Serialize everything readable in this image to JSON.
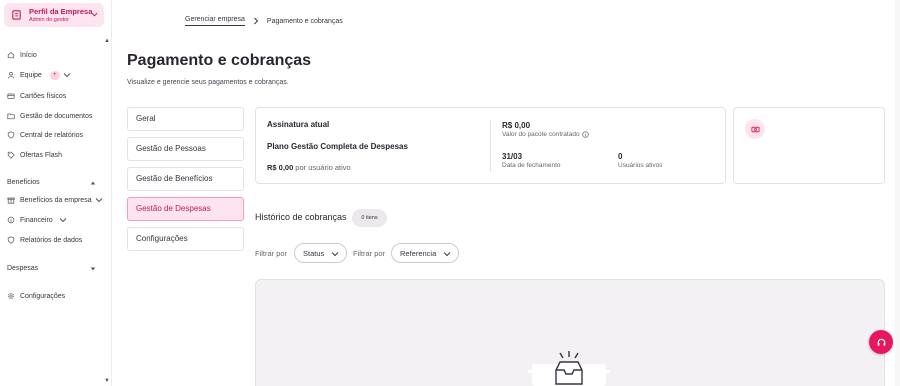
{
  "company": {
    "name": "Perfil da Empresa",
    "role": "Admin do gestor"
  },
  "sidebar": {
    "items": [
      {
        "label": "Início",
        "icon": "home-icon"
      },
      {
        "label": "Equipe",
        "icon": "users-icon",
        "badge": "+"
      },
      {
        "label": "Cartões físicos",
        "icon": "card-icon"
      },
      {
        "label": "Gestão de documentos",
        "icon": "folder-icon"
      },
      {
        "label": "Central de relatórios",
        "icon": "shield-icon"
      },
      {
        "label": "Ofertas Flash",
        "icon": "tag-icon"
      }
    ],
    "section_beneficios": "Benefícios",
    "beneficios_items": [
      {
        "label": "Benefícios da empresa",
        "icon": "gift-icon"
      },
      {
        "label": "Financeiro",
        "icon": "coin-icon"
      },
      {
        "label": "Relatórios de dados",
        "icon": "shield-icon"
      }
    ],
    "section_despesas": "Despesas",
    "settings": {
      "label": "Configurações",
      "icon": "gear-icon"
    }
  },
  "breadcrumb": {
    "parent": "Gerenciar empresa",
    "current": "Pagamento e cobranças"
  },
  "page": {
    "title": "Pagamento e cobranças",
    "subtitle": "Visualize e gerencie seus pagamentos e cobranças."
  },
  "nav": {
    "items": [
      "Geral",
      "Gestão de Pessoas",
      "Gestão de Benefícios",
      "Gestão de Despesas",
      "Configurações"
    ],
    "active_index": 3
  },
  "subscription": {
    "header": "Assinatura atual",
    "plan": "Plano Gestão Completa de Despesas",
    "price": "R$ 0,00",
    "price_unit": "por usuário ativo",
    "package_value": "R$ 0,00",
    "package_label": "Valor do pacote contratado",
    "closing_value": "31/03",
    "closing_label": "Data de fechamento",
    "users_value": "0",
    "users_label": "Usuários ativos"
  },
  "history": {
    "title": "Histórico de cobranças",
    "count_badge": "0 itens",
    "filter_label_1": "Filtrar por",
    "filter_1": "Status",
    "filter_label_2": "Filtrar por",
    "filter_2": "Referencia"
  },
  "colors": {
    "accent": "#e8175d",
    "accent_light": "#fde4ef",
    "brand_text": "#c2185b"
  }
}
